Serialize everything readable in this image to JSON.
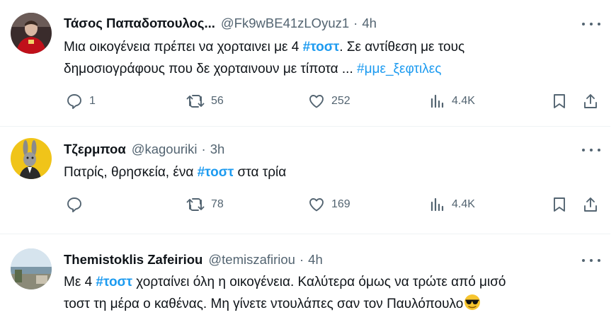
{
  "tweets": [
    {
      "name": "Τάσος Παπαδοπουλος...",
      "handle": "@Fk9wBE41zLOyuz1",
      "sep": "·",
      "time": "4h",
      "line1_pre": "Μια οικογένεια πρέπει να χορταινει με 4 ",
      "line1_tag": "#τοστ",
      "line1_post": ". Σε αντίθεση με τους",
      "line2_pre": "δημοσιογράφους που δε χορταινουν με τίποτα ... ",
      "line2_tag": "#μμε_ξεφτιλες",
      "replies": "1",
      "retweets": "56",
      "likes": "252",
      "views": "4.4K"
    },
    {
      "name": "Τζερμποα",
      "handle": "@kagouriki",
      "sep": "·",
      "time": "3h",
      "line1_pre": "Πατρίς, θρησκεία, ένα ",
      "line1_tag": "#τοστ",
      "line1_post": " στα τρία",
      "replies": "",
      "retweets": "78",
      "likes": "169",
      "views": "4.4K"
    },
    {
      "name": "Themistoklis Zafeiriou",
      "handle": "@temiszafiriou",
      "sep": "·",
      "time": "4h",
      "line1_pre": "Με 4 ",
      "line1_tag": "#τοστ",
      "line1_post": " χορταίνει όλη η οικογένεια. Καλύτερα όμως να τρώτε από μισό",
      "line2_pre": "τοστ τη μέρα ο καθένας. Μη γίνετε ντουλάπες σαν τον Παυλόπουλο"
    }
  ],
  "icons": {
    "reply": "reply-icon",
    "retweet": "retweet-icon",
    "like": "heart-icon",
    "views": "views-icon",
    "bookmark": "bookmark-icon",
    "share": "share-icon",
    "more": "more-icon",
    "emoji": "sunglasses-emoji"
  },
  "colors": {
    "link": "#1d9bf0",
    "text": "#0f1419",
    "secondary": "#536471"
  }
}
